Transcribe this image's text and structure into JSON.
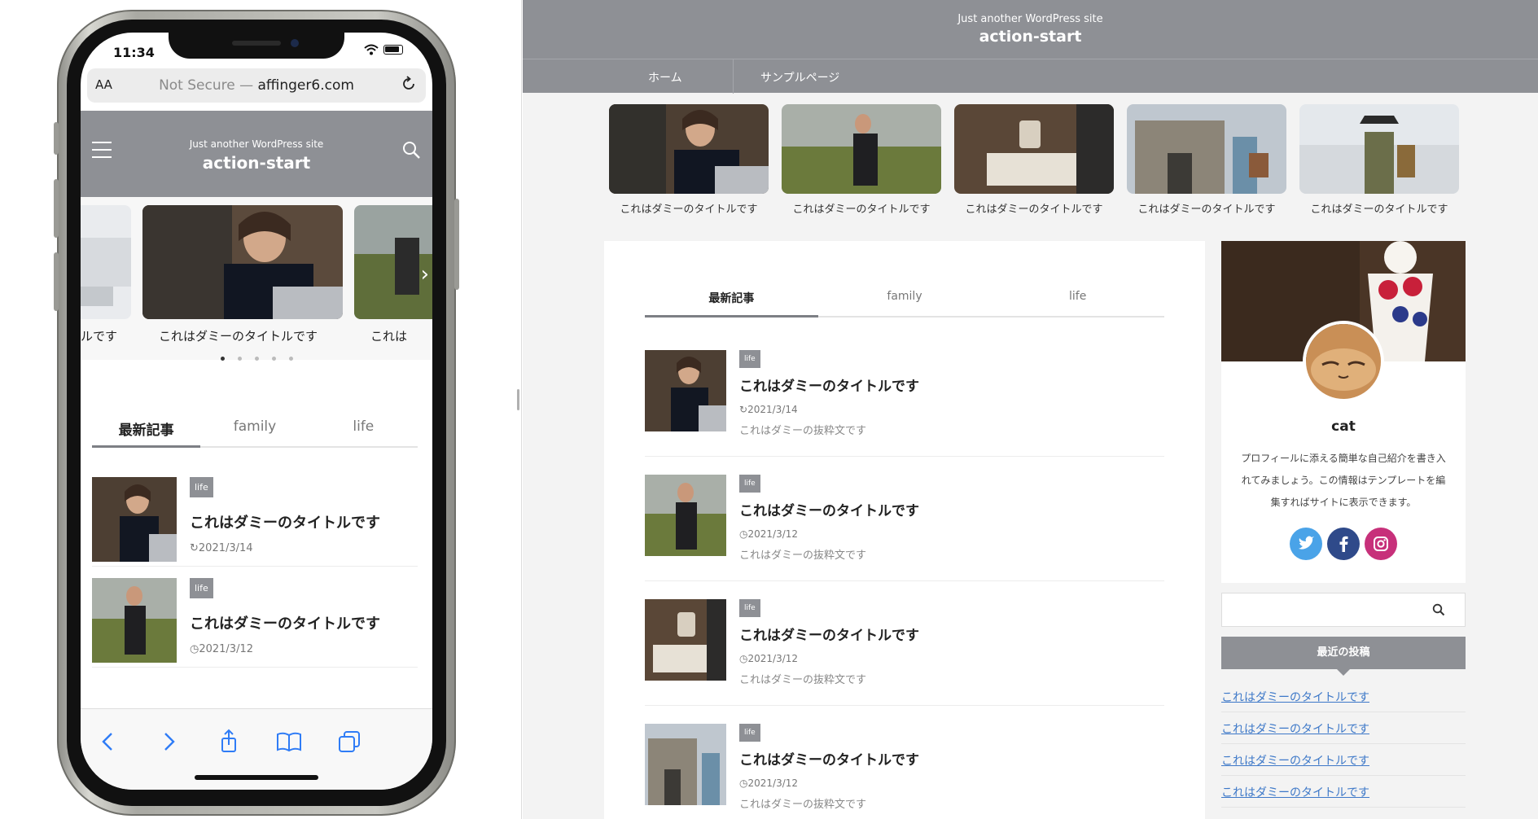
{
  "colors": {
    "header_gray": "#8e9095",
    "link_blue": "#3d78c8",
    "ios_blue": "#2f7cf6",
    "twitter": "#4aa3e8",
    "facebook": "#2f4a8a",
    "instagram": "#c7307a"
  },
  "mobile": {
    "status_time": "11:34",
    "url_aa": "AA",
    "url_not_secure": "Not Secure —",
    "url_domain": "affinger6.com",
    "site_tagline": "Just another WordPress site",
    "site_title": "action-start",
    "slides": [
      {
        "caption": "ルです"
      },
      {
        "caption": "これはダミーのタイトルです"
      },
      {
        "caption": "これは"
      }
    ],
    "tabs": [
      "最新記事",
      "family",
      "life"
    ],
    "posts": [
      {
        "category": "life",
        "title": "これはダミーのタイトルです",
        "date": "2021/3/14"
      },
      {
        "category": "life",
        "title": "これはダミーのタイトルです",
        "date": "2021/3/12"
      }
    ],
    "icons": {
      "menu": "menu-icon",
      "search": "search-icon",
      "reload": "reload-icon",
      "back": "back-icon",
      "forward": "forward-icon",
      "share": "share-icon",
      "bookmarks": "bookmarks-icon",
      "tabs": "tabs-icon"
    }
  },
  "desktop": {
    "site_tagline": "Just another WordPress site",
    "site_title": "action-start",
    "nav": [
      "ホーム",
      "サンプルページ"
    ],
    "featured": [
      {
        "caption": "これはダミーのタイトルです"
      },
      {
        "caption": "これはダミーのタイトルです"
      },
      {
        "caption": "これはダミーのタイトルです"
      },
      {
        "caption": "これはダミーのタイトルです"
      },
      {
        "caption": "これはダミーのタイトルです"
      }
    ],
    "tabs": [
      "最新記事",
      "family",
      "life"
    ],
    "posts": [
      {
        "category": "life",
        "title": "これはダミーのタイトルです",
        "date": "2021/3/14",
        "excerpt": "これはダミーの抜粋文です"
      },
      {
        "category": "life",
        "title": "これはダミーのタイトルです",
        "date": "2021/3/12",
        "excerpt": "これはダミーの抜粋文です"
      },
      {
        "category": "life",
        "title": "これはダミーのタイトルです",
        "date": "2021/3/12",
        "excerpt": "これはダミーの抜粋文です"
      },
      {
        "category": "life",
        "title": "これはダミーのタイトルです",
        "date": "2021/3/12",
        "excerpt": "これはダミーの抜粋文です"
      }
    ],
    "profile": {
      "name": "cat",
      "description": "プロフィールに添える簡単な自己紹介を書き入れてみましょう。この情報はテンプレートを編集すればサイトに表示できます。",
      "social": [
        "twitter-icon",
        "facebook-icon",
        "instagram-icon"
      ]
    },
    "search_icon": "search-icon",
    "recent_heading": "最近の投稿",
    "recent_posts": [
      "これはダミーのタイトルです",
      "これはダミーのタイトルです",
      "これはダミーのタイトルです",
      "これはダミーのタイトルです"
    ]
  }
}
